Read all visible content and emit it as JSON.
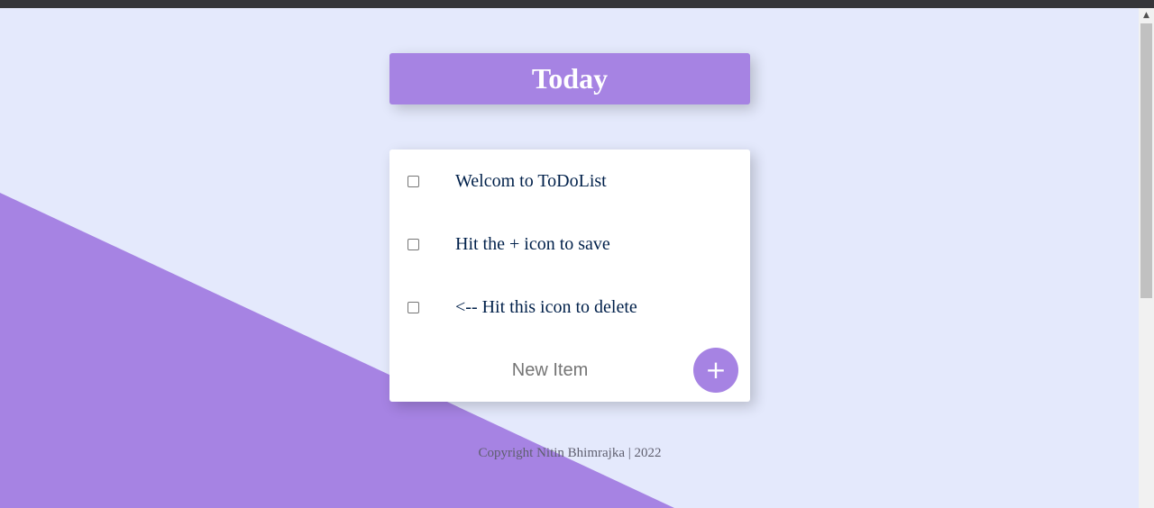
{
  "colors": {
    "page_background": "#E4E9FC",
    "accent": "#A683E3",
    "item_text": "#00204A",
    "card_background": "#FFFFFF"
  },
  "heading": {
    "title": "Today"
  },
  "todo": {
    "items": [
      {
        "label": "Welcom to ToDoList",
        "checked": false
      },
      {
        "label": "Hit the + icon to save",
        "checked": false
      },
      {
        "label": "<-- Hit this icon to delete",
        "checked": false
      }
    ],
    "new_item_placeholder": "New Item",
    "add_button_label": "+",
    "add_button_icon": "plus-icon"
  },
  "footer": {
    "text": "Copyright Nitin Bhimrajka | 2022"
  },
  "scrollbar": {
    "up_arrow": "▲",
    "up_arrow_icon": "scroll-up-arrow-icon"
  }
}
